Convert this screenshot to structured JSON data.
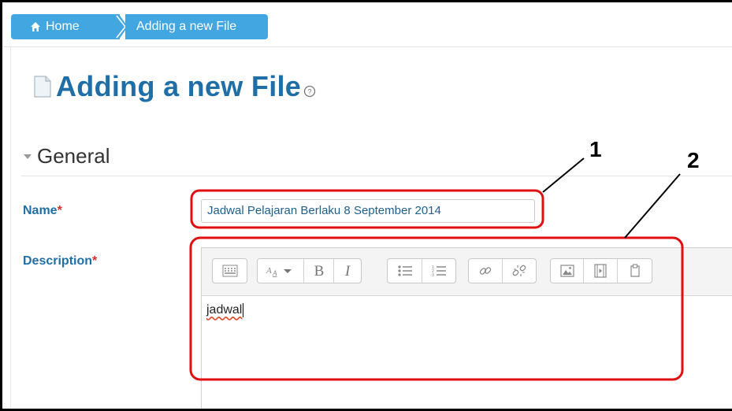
{
  "breadcrumb": {
    "home_label": "Home",
    "current_label": "Adding a new File"
  },
  "page": {
    "title": "Adding a new File"
  },
  "section": {
    "title": "General"
  },
  "form": {
    "name_label": "Name",
    "name_required": "*",
    "name_value": "Jadwal Pelajaran Berlaku 8 September 2014",
    "description_label": "Description",
    "description_required": "*",
    "description_content": "jadwal"
  },
  "editor_toolbar": {
    "groups": [
      [
        "toolbar-toggle-icon"
      ],
      [
        "font-size-icon",
        "bold-icon",
        "italic-icon"
      ],
      [
        "unordered-list-icon",
        "ordered-list-icon"
      ],
      [
        "link-icon",
        "unlink-icon"
      ],
      [
        "image-icon",
        "media-icon",
        "file-manage-icon"
      ]
    ]
  },
  "annotations": {
    "label_1": "1",
    "label_2": "2"
  },
  "colors": {
    "breadcrumb_bg": "#42a6e0",
    "title_blue": "#1f6fa6",
    "required_red": "#d9302c",
    "annotation_red": "#e01010"
  }
}
